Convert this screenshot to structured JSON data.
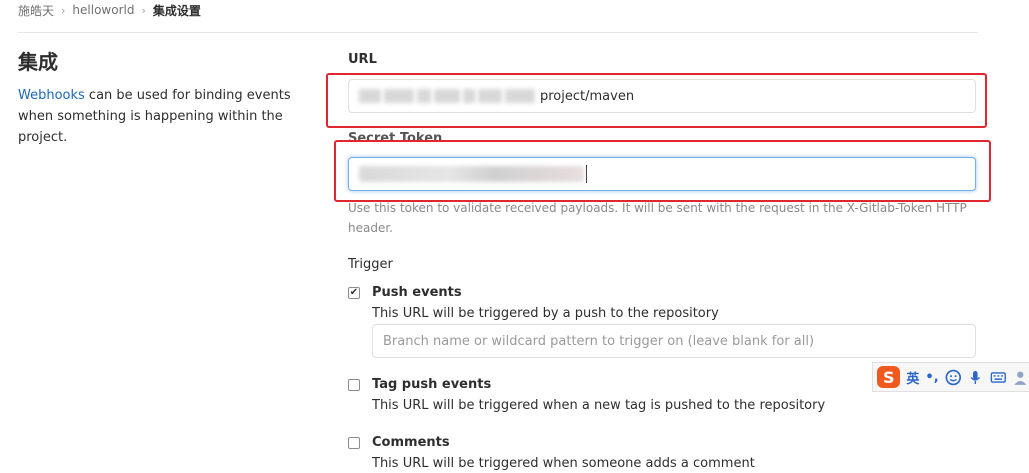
{
  "breadcrumb": {
    "items": [
      "施皓天",
      "helloworld"
    ],
    "current": "集成设置"
  },
  "section": {
    "title": "集成",
    "link_text": "Webhooks",
    "description_rest": " can be used for binding events when something is happening within the project."
  },
  "url_field": {
    "label": "URL",
    "value_visible": "project/maven"
  },
  "secret_field": {
    "label": "Secret Token",
    "help": "Use this token to validate received payloads. It will be sent with the request in the X-Gitlab-Token HTTP header."
  },
  "trigger": {
    "label": "Trigger",
    "push": {
      "checked": true,
      "title": "Push events",
      "description": "This URL will be triggered by a push to the repository",
      "branch_placeholder": "Branch name or wildcard pattern to trigger on (leave blank for all)"
    },
    "tag_push": {
      "checked": false,
      "title": "Tag push events",
      "description": "This URL will be triggered when a new tag is pushed to the repository"
    },
    "comments": {
      "checked": false,
      "title": "Comments",
      "description": "This URL will be triggered when someone adds a comment"
    }
  },
  "ime_toolbar": {
    "logo": "S",
    "language": "英",
    "punctuation": "•,",
    "icons": [
      "emoji-icon",
      "microphone-icon",
      "keyboard-icon",
      "user-icon"
    ]
  },
  "colors": {
    "link": "#1b69b6",
    "annotation_red": "#e2262b",
    "focus_blue": "#73afea",
    "ime_orange": "#f05a1e"
  }
}
